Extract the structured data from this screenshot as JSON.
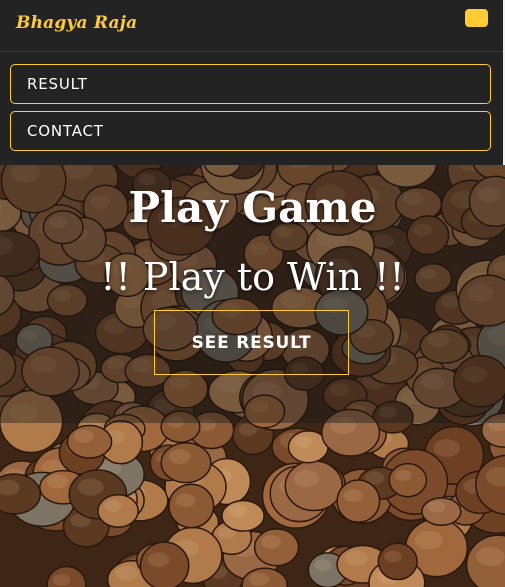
{
  "navbar": {
    "brand": "Bhagya Raja",
    "menu_toggle_icon": "menu-toggle-icon",
    "items": [
      {
        "label": "RESULT"
      },
      {
        "label": "CONTACT"
      }
    ]
  },
  "hero": {
    "title": "Play Game",
    "subtitle": "!! Play to Win !!",
    "cta_label": "SEE RESULT",
    "background": "coins-photo"
  },
  "colors": {
    "accent": "#ffcc33",
    "navbar_bg": "#232323",
    "text": "#ffffff"
  }
}
